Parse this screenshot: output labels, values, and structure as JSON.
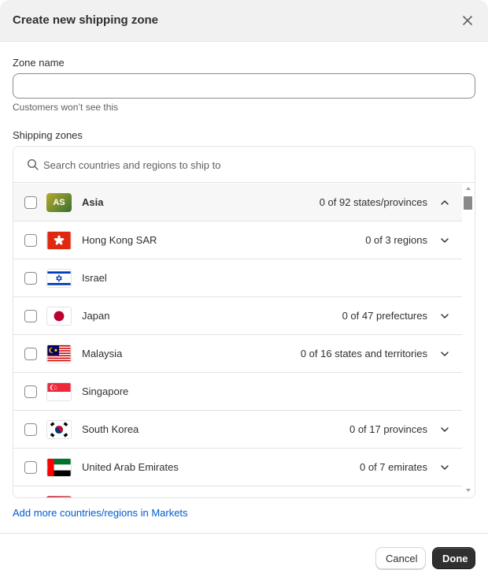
{
  "modal": {
    "title": "Create new shipping zone"
  },
  "zone_name": {
    "label": "Zone name",
    "value": "",
    "placeholder": "",
    "help": "Customers won’t see this"
  },
  "shipping_zones": {
    "label": "Shipping zones",
    "search_placeholder": "Search countries and regions to ship to",
    "group": {
      "badge": "AS",
      "name": "Asia",
      "count": "0 of 92 states/provinces",
      "expanded": true
    },
    "countries": [
      {
        "name": "Hong Kong SAR",
        "flag": "hong-kong-flag",
        "count": "0 of 3 regions",
        "has_children": true
      },
      {
        "name": "Israel",
        "flag": "israel-flag",
        "count": "",
        "has_children": false
      },
      {
        "name": "Japan",
        "flag": "japan-flag",
        "count": "0 of 47 prefectures",
        "has_children": true
      },
      {
        "name": "Malaysia",
        "flag": "malaysia-flag",
        "count": "0 of 16 states and territories",
        "has_children": true
      },
      {
        "name": "Singapore",
        "flag": "singapore-flag",
        "count": "",
        "has_children": false
      },
      {
        "name": "South Korea",
        "flag": "south-korea-flag",
        "count": "0 of 17 provinces",
        "has_children": true
      },
      {
        "name": "United Arab Emirates",
        "flag": "uae-flag",
        "count": "0 of 7 emirates",
        "has_children": true
      }
    ]
  },
  "markets_link": "Add more countries/regions in Markets",
  "footer": {
    "cancel_label": "Cancel",
    "done_label": "Done"
  },
  "colors": {
    "link": "#005bd3",
    "primary_button": "#303030",
    "header_bg": "#f1f1f1",
    "border": "#e3e3e3"
  }
}
